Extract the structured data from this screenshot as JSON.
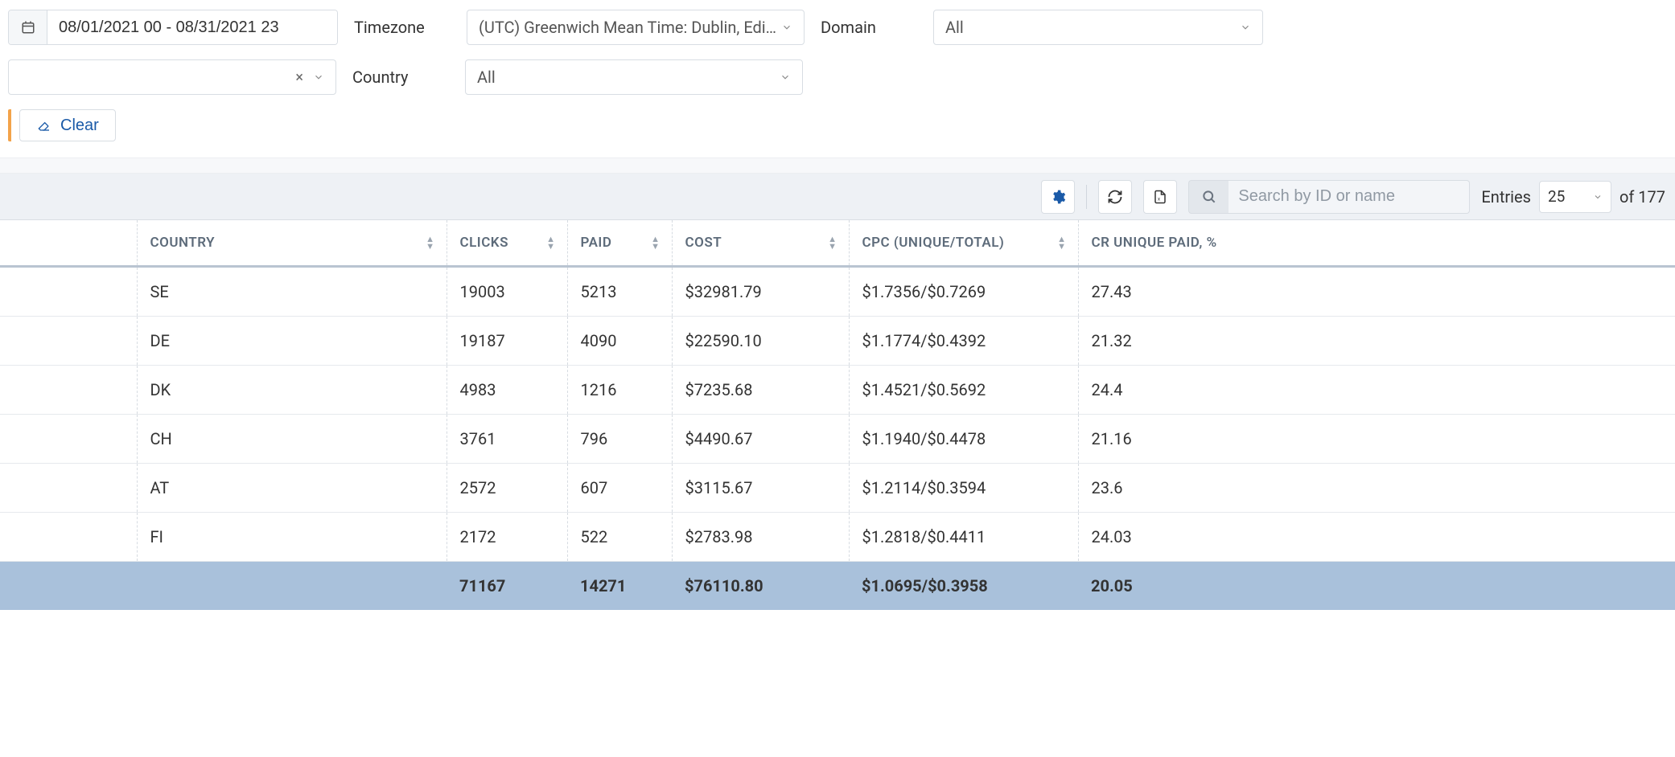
{
  "filters": {
    "date_range": "08/01/2021 00 - 08/31/2021 23",
    "timezone_label": "Timezone",
    "timezone_value": "(UTC) Greenwich Mean Time: Dublin, Edinbur…",
    "domain_label": "Domain",
    "domain_value": "All",
    "country_label": "Country",
    "country_value": "All",
    "clear_label": "Clear"
  },
  "toolbar": {
    "search_placeholder": "Search by ID or name",
    "entries_label": "Entries",
    "entries_value": "25",
    "entries_of": "of 177"
  },
  "table": {
    "headers": {
      "country": "COUNTRY",
      "clicks": "CLICKS",
      "paid": "PAID",
      "cost": "COST",
      "cpc": "CPC (UNIQUE/TOTAL)",
      "cr": "CR UNIQUE PAID, %"
    },
    "rows": [
      {
        "country": "SE",
        "clicks": "19003",
        "paid": "5213",
        "cost": "$32981.79",
        "cpc": "$1.7356/$0.7269",
        "cr": "27.43"
      },
      {
        "country": "DE",
        "clicks": "19187",
        "paid": "4090",
        "cost": "$22590.10",
        "cpc": "$1.1774/$0.4392",
        "cr": "21.32"
      },
      {
        "country": "DK",
        "clicks": "4983",
        "paid": "1216",
        "cost": "$7235.68",
        "cpc": "$1.4521/$0.5692",
        "cr": "24.4"
      },
      {
        "country": "CH",
        "clicks": "3761",
        "paid": "796",
        "cost": "$4490.67",
        "cpc": "$1.1940/$0.4478",
        "cr": "21.16"
      },
      {
        "country": "AT",
        "clicks": "2572",
        "paid": "607",
        "cost": "$3115.67",
        "cpc": "$1.2114/$0.3594",
        "cr": "23.6"
      },
      {
        "country": "FI",
        "clicks": "2172",
        "paid": "522",
        "cost": "$2783.98",
        "cpc": "$1.2818/$0.4411",
        "cr": "24.03"
      }
    ],
    "totals": {
      "clicks": "71167",
      "paid": "14271",
      "cost": "$76110.80",
      "cpc": "$1.0695/$0.3958",
      "cr": "20.05"
    }
  }
}
